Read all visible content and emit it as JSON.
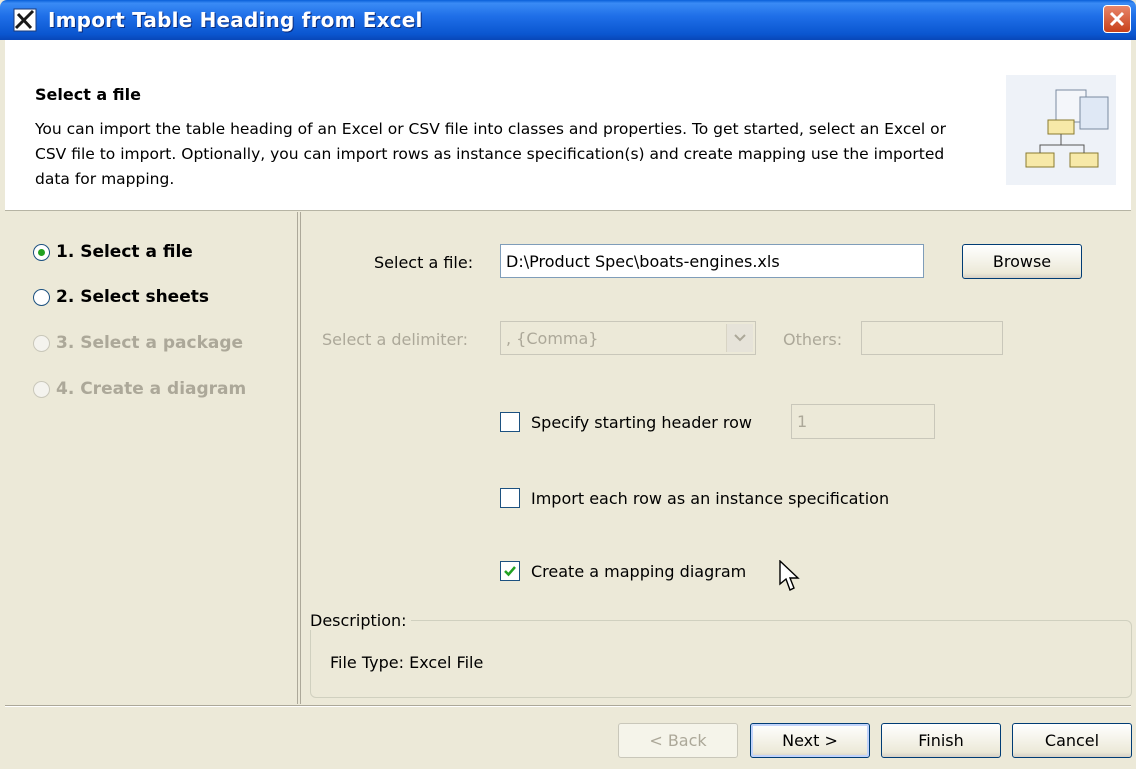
{
  "window": {
    "title": "Import Table Heading from Excel"
  },
  "header": {
    "title": "Select a file",
    "description": "You can import the table heading of an Excel or CSV file into classes and properties. To get started, select an Excel or CSV file to import. Optionally, you can import rows as instance specification(s) and create mapping use the imported data for mapping."
  },
  "steps": [
    {
      "label": "1. Select a file",
      "state": "current"
    },
    {
      "label": "2. Select sheets",
      "state": "enabled"
    },
    {
      "label": "3. Select a package",
      "state": "disabled"
    },
    {
      "label": "4. Create a diagram",
      "state": "disabled"
    }
  ],
  "form": {
    "file_label": "Select a file:",
    "file_value": "D:\\Product Spec\\boats-engines.xls",
    "browse_label": "Browse",
    "delimiter_label": "Select a delimiter:",
    "delimiter_value": ", {Comma}",
    "others_label": "Others:",
    "others_value": "",
    "header_row_label": "Specify starting header row",
    "header_row_checked": false,
    "header_row_value": "1",
    "instance_label": "Import each row as an instance specification",
    "instance_checked": false,
    "mapping_label": "Create a mapping diagram",
    "mapping_checked": true
  },
  "description": {
    "legend": "Description:",
    "text": "File Type: Excel File"
  },
  "footer": {
    "back_label": "< Back",
    "next_label": "Next >",
    "finish_label": "Finish",
    "cancel_label": "Cancel"
  },
  "colors": {
    "titlebar": "#0A56D0",
    "dialog_bg": "#ECE9D8",
    "current_step_dot": "#21A121",
    "disabled_text": "#ACA899"
  },
  "icons": [
    "app-icon",
    "close-icon",
    "wizard-illustration-icon",
    "dropdown-arrow-icon",
    "checkmark-icon",
    "mouse-cursor-icon"
  ]
}
